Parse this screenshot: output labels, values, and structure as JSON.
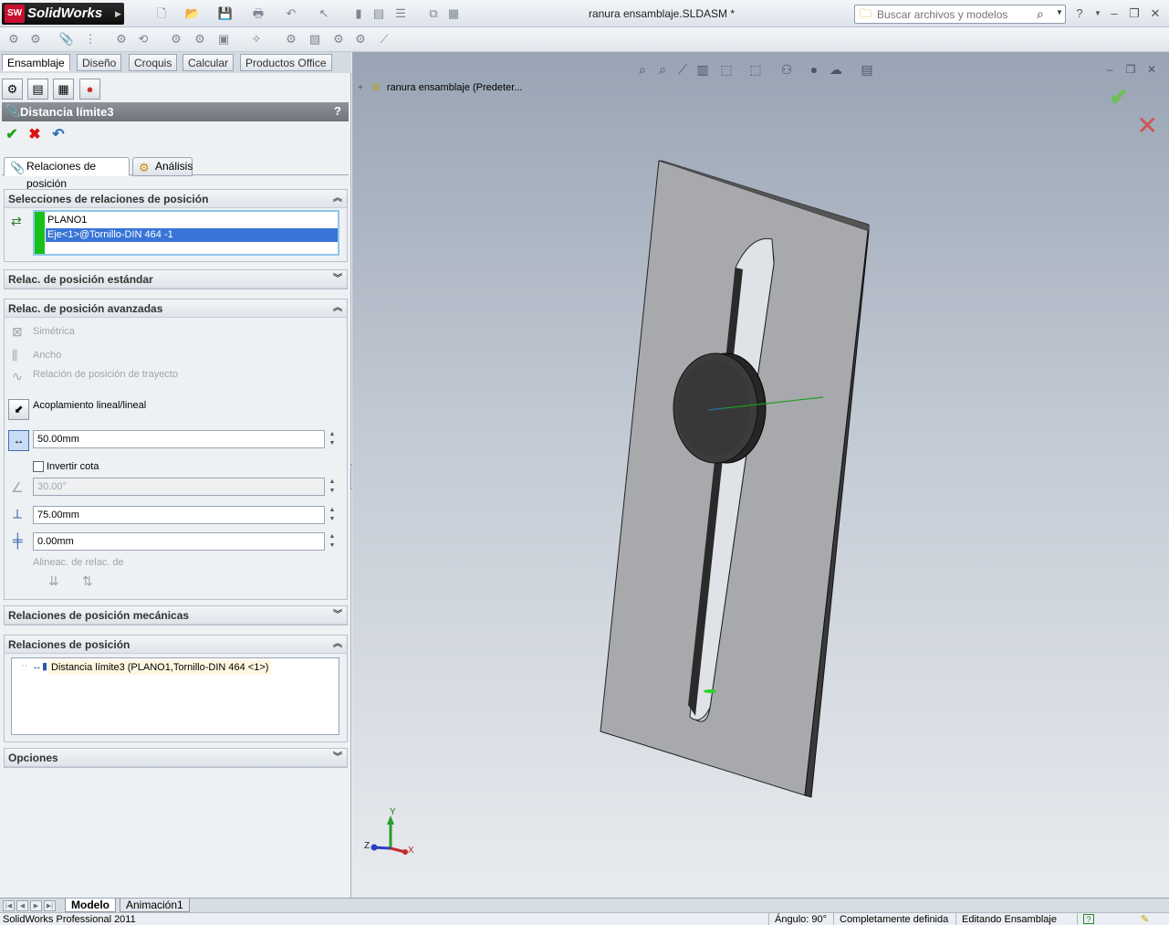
{
  "app": {
    "name": "SolidWorks",
    "document_title": "ranura ensamblaje.SLDASM *",
    "search_placeholder": "Buscar archivos y modelos"
  },
  "command_tabs": [
    "Ensamblaje",
    "Diseño",
    "Croquis",
    "Calcular",
    "Productos Office"
  ],
  "property_manager": {
    "title": "Distancia límite3",
    "help": "?",
    "tabs": [
      "Relaciones de posición",
      "Análisis"
    ],
    "groups": {
      "selections": {
        "title": "Selecciones de relaciones de posición",
        "items": [
          "PLANO1",
          "Eje<1>@Tornillo-DIN 464 -1"
        ]
      },
      "standard": {
        "title": "Relac. de posición estándar"
      },
      "advanced": {
        "title": "Relac. de posición avanzadas",
        "symmetric": "Simétrica",
        "width": "Ancho",
        "path": "Relación de posición de trayecto",
        "linear": "Acoplamiento lineal/lineal",
        "distance_value": "50.00mm",
        "flip_label": "Invertir cota",
        "angle_value": "30.00°",
        "max_value": "75.00mm",
        "min_value": "0.00mm",
        "alignment_label": "Alineac. de relac. de"
      },
      "mechanical": {
        "title": "Relaciones de posición mecánicas"
      },
      "mates": {
        "title": "Relaciones de posición",
        "items": [
          "Distancia límite3 (PLANO1,Tornillo-DIN 464 <1>)"
        ]
      },
      "options": {
        "title": "Opciones"
      }
    }
  },
  "graphics": {
    "tree_root": "ranura ensamblaje  (Predeter...",
    "triad": {
      "x": "X",
      "y": "Y",
      "z": "Z"
    }
  },
  "bottom_tabs": [
    "Modelo",
    "Animación1"
  ],
  "status": {
    "app_version": "SolidWorks Professional 2011",
    "angle": "Ángulo: 90°",
    "definition": "Completamente definida",
    "mode": "Editando Ensamblaje",
    "help": "?"
  }
}
